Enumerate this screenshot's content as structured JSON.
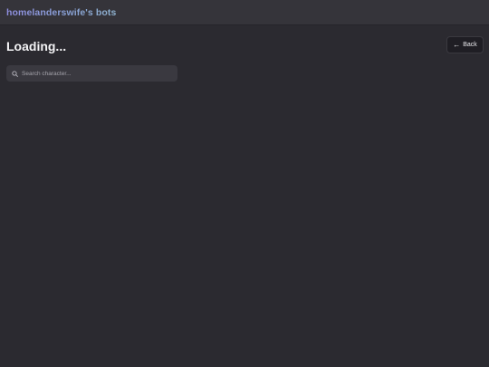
{
  "header": {
    "brand": "homelanderswife's bots"
  },
  "page": {
    "title": "Loading..."
  },
  "back_button": {
    "label": "Back",
    "icon": "arrow-left-icon"
  },
  "search": {
    "placeholder": "Search character...",
    "value": "",
    "icon": "search-icon"
  }
}
